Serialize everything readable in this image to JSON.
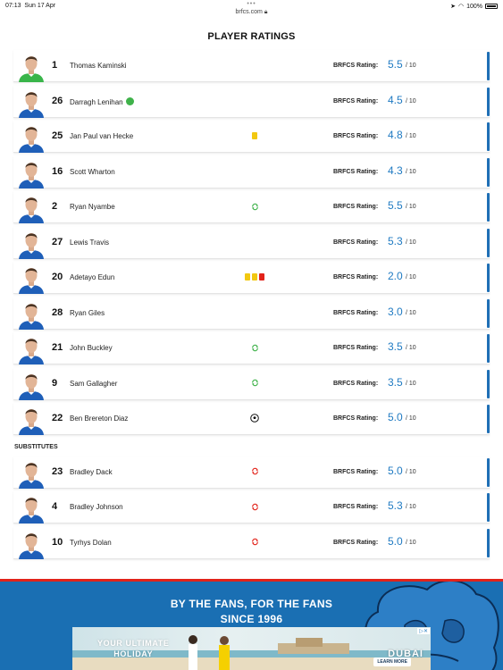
{
  "status_bar": {
    "time": "07:13",
    "date": "Sun 17 Apr",
    "url": "brfcs.com",
    "battery": "100%"
  },
  "title": "PLAYER RATINGS",
  "rating_label": "BRFCS Rating:",
  "rating_max": "/ 10",
  "substitutes_heading": "SUBSTITUTES",
  "colors": {
    "accent": "#1f6fb5",
    "rating": "#1f7ac2",
    "yellow_card": "#f2c811",
    "red_card": "#e2231a",
    "footer": "#1a6fb3"
  },
  "starters": [
    {
      "number": "1",
      "name": "Thomas Kaminski",
      "rating": "5.5",
      "events": [],
      "kit": "goalkeeper"
    },
    {
      "number": "26",
      "name": "Darragh Lenihan",
      "rating": "4.5",
      "events": [],
      "captain_badge": true,
      "kit": "outfield"
    },
    {
      "number": "25",
      "name": "Jan Paul van Hecke",
      "rating": "4.8",
      "events": [
        "yellow-card"
      ],
      "kit": "outfield"
    },
    {
      "number": "16",
      "name": "Scott Wharton",
      "rating": "4.3",
      "events": [],
      "kit": "outfield"
    },
    {
      "number": "2",
      "name": "Ryan Nyambe",
      "rating": "5.5",
      "events": [
        "sub-off"
      ],
      "kit": "outfield"
    },
    {
      "number": "27",
      "name": "Lewis Travis",
      "rating": "5.3",
      "events": [],
      "kit": "outfield"
    },
    {
      "number": "20",
      "name": "Adetayo Edun",
      "rating": "2.0",
      "events": [
        "yellow-card",
        "yellow-card",
        "red-card"
      ],
      "kit": "outfield"
    },
    {
      "number": "28",
      "name": "Ryan Giles",
      "rating": "3.0",
      "events": [],
      "kit": "outfield"
    },
    {
      "number": "21",
      "name": "John Buckley",
      "rating": "3.5",
      "events": [
        "sub-off"
      ],
      "kit": "outfield"
    },
    {
      "number": "9",
      "name": "Sam Gallagher",
      "rating": "3.5",
      "events": [
        "sub-off"
      ],
      "kit": "outfield"
    },
    {
      "number": "22",
      "name": "Ben Brereton Diaz",
      "rating": "5.0",
      "events": [
        "goal"
      ],
      "kit": "outfield"
    }
  ],
  "substitutes": [
    {
      "number": "23",
      "name": "Bradley Dack",
      "rating": "5.0",
      "events": [
        "sub-on"
      ],
      "kit": "outfield"
    },
    {
      "number": "4",
      "name": "Bradley Johnson",
      "rating": "5.3",
      "events": [
        "sub-on"
      ],
      "kit": "outfield"
    },
    {
      "number": "10",
      "name": "Tyrhys Dolan",
      "rating": "5.0",
      "events": [
        "sub-on"
      ],
      "kit": "outfield"
    }
  ],
  "footer": {
    "tagline_line1": "BY THE FANS, FOR THE FANS",
    "tagline_line2": "SINCE 1996",
    "ad": {
      "headline_line1": "YOUR ULTIMATE",
      "headline_line2": "HOLIDAY",
      "cta": "LEARN MORE",
      "brand": "DUBAI"
    }
  }
}
